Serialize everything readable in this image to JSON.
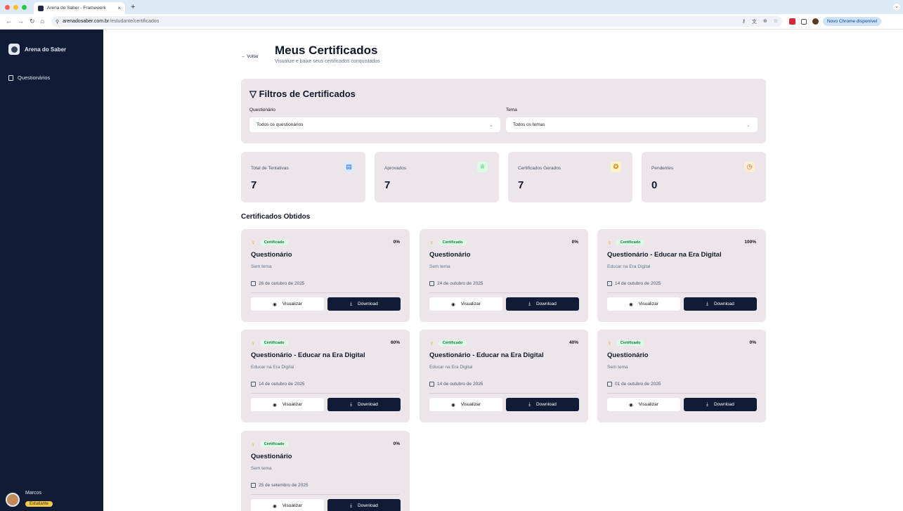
{
  "browser": {
    "tab_title": "Arena do Saber - Framework",
    "tab_close": "×",
    "new_tab": "+",
    "url_host": "arenadosaber.com.br",
    "url_path": "/estudante/certificados",
    "chrome_update_label": "Novo Chrome disponível"
  },
  "sidebar": {
    "brand": "Arena do Saber",
    "items": [
      {
        "label": "Questionários",
        "icon": "clipboard-icon"
      }
    ],
    "user": {
      "name": "Marcos",
      "role": "Estudante"
    }
  },
  "header": {
    "back_label": "← Voltar",
    "title": "Meus Certificados",
    "subtitle": "Visualize e baixe seus certificados conquistados"
  },
  "filters": {
    "title": "▽ Filtros de Certificados",
    "questionario_label": "Questionário",
    "questionario_value": "Todos os questionários",
    "tema_label": "Tema",
    "tema_value": "Todos os temas"
  },
  "stats": [
    {
      "label": "Total de Tentativas",
      "value": "7",
      "icon": "document-icon",
      "color": "#2563eb",
      "bg": "#dbeafe"
    },
    {
      "label": "Aprovados",
      "value": "7",
      "icon": "trophy-icon",
      "color": "#16a34a",
      "bg": "#dcfce7"
    },
    {
      "label": "Certificados Gerados",
      "value": "7",
      "icon": "award-icon",
      "color": "#d97706",
      "bg": "#fef3c7"
    },
    {
      "label": "Pendentes",
      "value": "0",
      "icon": "clock-icon",
      "color": "#ea580c",
      "bg": "#ffedd5"
    }
  ],
  "section_title": "Certificados Obtidos",
  "card_common": {
    "badge": "Certificado",
    "view_label": "Visualizar",
    "download_label": "Download"
  },
  "certificates": [
    {
      "title": "Questionário",
      "theme": "Sem tema",
      "date": "26 de outubro de 2025",
      "percent": "0%"
    },
    {
      "title": "Questionário",
      "theme": "Sem tema",
      "date": "24 de outubro de 2025",
      "percent": "0%"
    },
    {
      "title": "Questionário - Educar na Era Digital",
      "theme": "Educar na Era Digital",
      "date": "14 de outubro de 2025",
      "percent": "100%"
    },
    {
      "title": "Questionário - Educar na Era Digital",
      "theme": "Educar na Era Digital",
      "date": "14 de outubro de 2025",
      "percent": "60%"
    },
    {
      "title": "Questionário - Educar na Era Digital",
      "theme": "Educar na Era Digital",
      "date": "14 de outubro de 2025",
      "percent": "40%"
    },
    {
      "title": "Questionário",
      "theme": "Sem tema",
      "date": "01 de outubro de 2025",
      "percent": "0%"
    },
    {
      "title": "Questionário",
      "theme": "Sem tema",
      "date": "25 de setembro de 2025",
      "percent": "0%"
    }
  ]
}
